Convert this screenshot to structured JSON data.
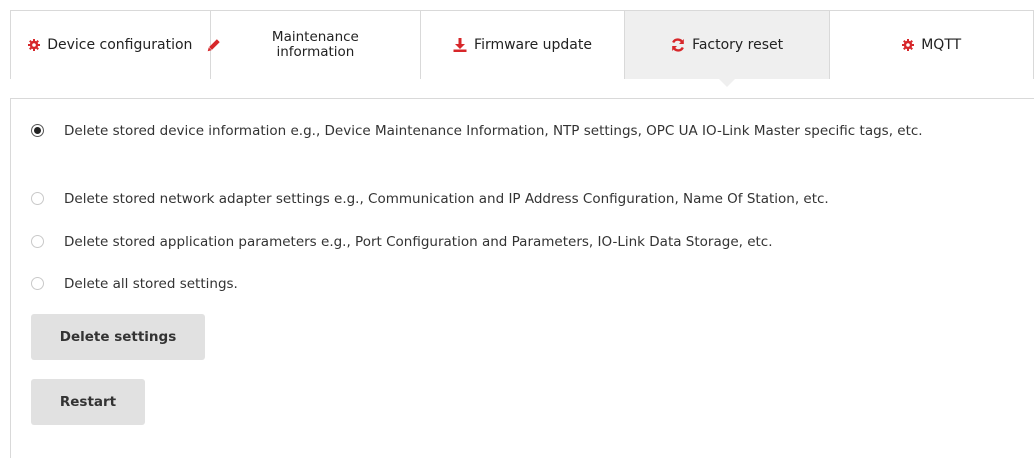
{
  "tabs": {
    "device_configuration": "Device configuration",
    "maintenance_information_line1": "Maintenance",
    "maintenance_information_line2": "information",
    "firmware_update": "Firmware update",
    "factory_reset": "Factory reset",
    "mqtt": "MQTT",
    "active": "Factory reset"
  },
  "colors": {
    "accent": "#d7272a",
    "active_tab_bg": "#efefef",
    "button_bg": "#e1e1e1"
  },
  "icons": {
    "device_configuration": "gear-icon",
    "maintenance_information": "pencil-icon",
    "firmware_update": "download-icon",
    "factory_reset": "refresh-icon",
    "mqtt": "gear-icon"
  },
  "options": {
    "selected": "device_information",
    "device_information": "Delete stored device information e.g., Device Maintenance Information, NTP settings, OPC UA IO-Link Master specific tags, etc.",
    "network_adapter": "Delete stored network adapter settings e.g., Communication and IP Address Configuration, Name Of Station, etc.",
    "application_parameters": "Delete stored application parameters e.g., Port Configuration and Parameters, IO-Link Data Storage, etc.",
    "all_settings": "Delete all stored settings."
  },
  "buttons": {
    "delete_settings": "Delete settings",
    "restart": "Restart"
  }
}
